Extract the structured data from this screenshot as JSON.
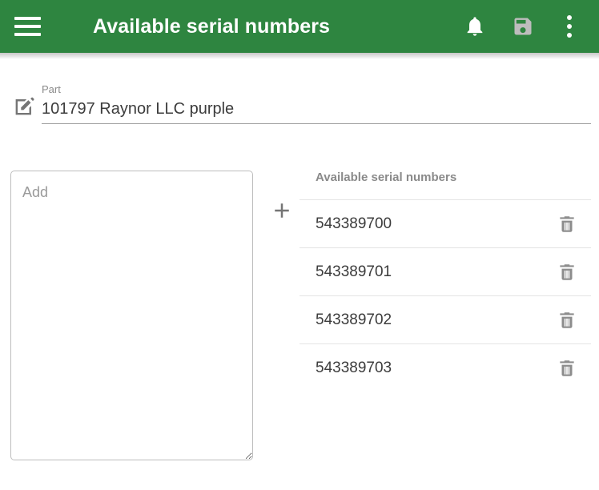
{
  "theme": {
    "appbar_color": "#2e8540",
    "appbar_text_color": "#ffffff",
    "save_icon_color": "#bdbdbd",
    "icon_gray": "#757575",
    "divider_color": "#e4e4e4",
    "label_gray": "#8a8a8a"
  },
  "appbar": {
    "menu_label": "Menu",
    "title": "Available serial numbers",
    "notifications_label": "Notifications",
    "save_label": "Save",
    "more_label": "More options"
  },
  "part": {
    "label": "Part",
    "value": "101797 Raynor LLC purple",
    "edit_label": "Edit part"
  },
  "add_panel": {
    "placeholder": "Add",
    "value": "",
    "add_button_label": "Add"
  },
  "serials": {
    "title": "Available serial numbers",
    "delete_label": "Delete",
    "items": [
      {
        "value": "543389700"
      },
      {
        "value": "543389701"
      },
      {
        "value": "543389702"
      },
      {
        "value": "543389703"
      }
    ]
  }
}
